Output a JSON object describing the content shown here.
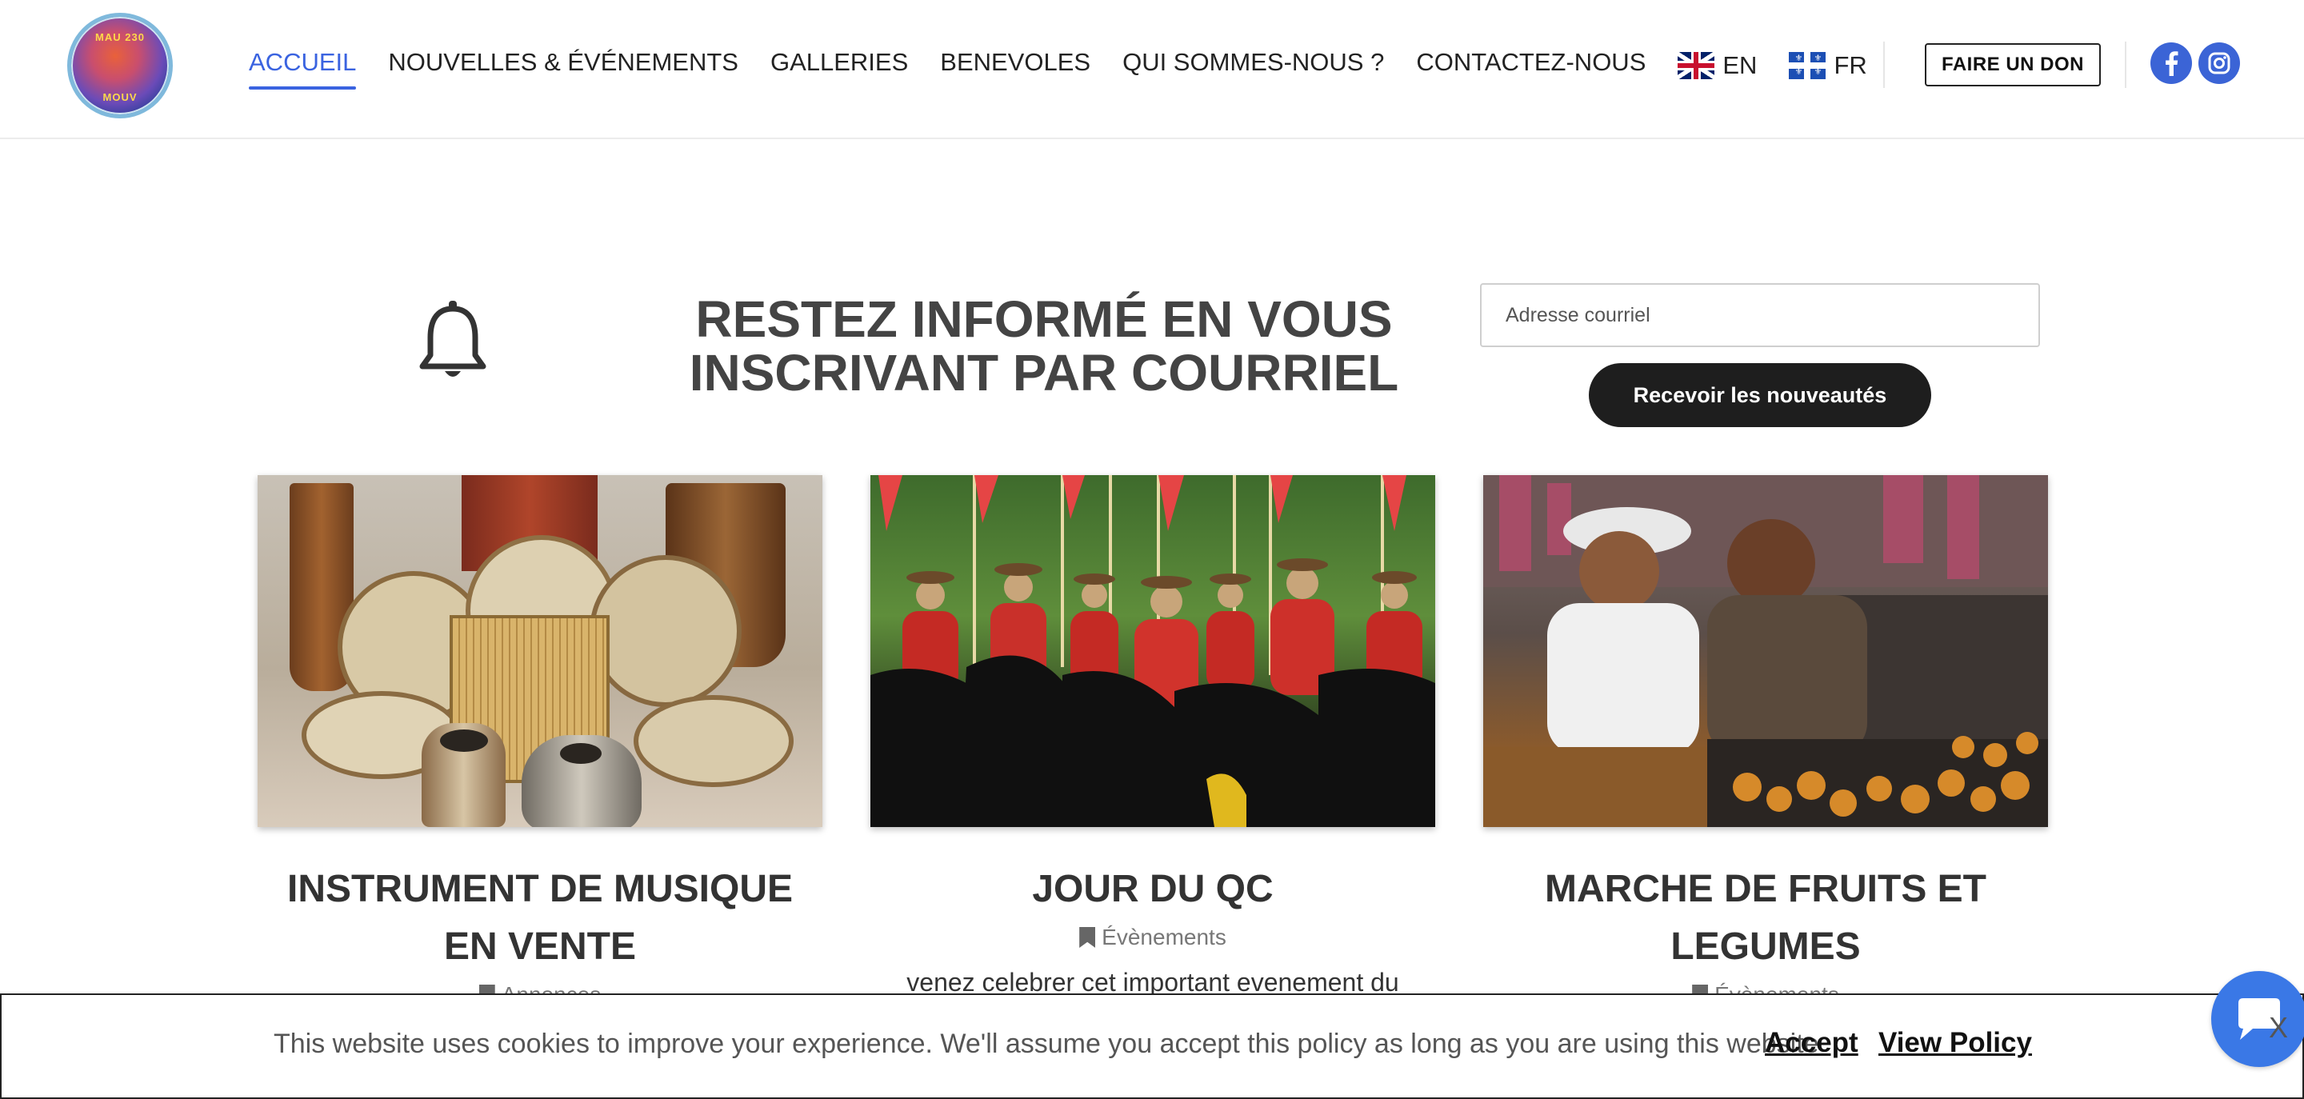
{
  "header": {
    "logo": {
      "text_top": "MAU 230",
      "text_bottom": "MOUV"
    },
    "nav": [
      {
        "label": "ACCUEIL",
        "active": true
      },
      {
        "label": "NOUVELLES & ÉVÉNEMENTS",
        "active": false
      },
      {
        "label": "GALLERIES",
        "active": false
      },
      {
        "label": "BENEVOLES",
        "active": false
      },
      {
        "label": "QUI SOMMES-NOUS ?",
        "active": false
      },
      {
        "label": "CONTACTEZ-NOUS",
        "active": false
      }
    ],
    "languages": [
      {
        "code": "EN",
        "flag": "uk-flag-icon"
      },
      {
        "code": "FR",
        "flag": "quebec-flag-icon"
      }
    ],
    "donate_label": "FAIRE UN DON",
    "social": [
      "facebook-icon",
      "instagram-icon"
    ],
    "accent_color": "#3a63e0"
  },
  "newsletter": {
    "icon": "bell-icon",
    "title": "RESTEZ INFORMÉ EN VOUS INSCRIVANT PAR COURRIEL",
    "email_placeholder": "Adresse courriel",
    "button_label": "Recevoir les nouveautés"
  },
  "cards": [
    {
      "title": "INSTRUMENT DE MUSIQUE EN VENTE",
      "category": "Annonces",
      "excerpt": ""
    },
    {
      "title": "JOUR DU QC",
      "category": "Évènements",
      "excerpt": "venez celebrer cet important evenement du"
    },
    {
      "title": "MARCHE DE FRUITS ET LEGUMES",
      "category": "Évènements",
      "excerpt": ""
    }
  ],
  "cookie_bar": {
    "message": "This website uses cookies to improve your experience. We'll assume you accept this policy as long as you are using this website",
    "accept_label": "Accept",
    "policy_label": "View Policy",
    "close_label": "X"
  },
  "chat": {
    "icon": "chat-bubble-icon"
  }
}
